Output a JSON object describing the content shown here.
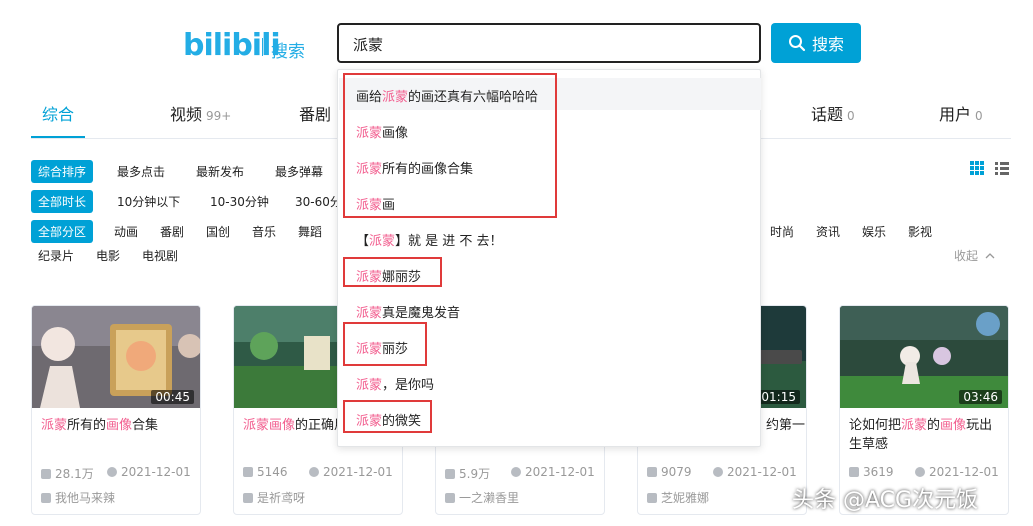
{
  "header": {
    "logo": "bilibili",
    "logo_sub": "搜索",
    "search_value": "派蒙",
    "search_button": "搜索"
  },
  "tabs": [
    {
      "label": "综合",
      "count": ""
    },
    {
      "label": "视频",
      "count": "99+"
    },
    {
      "label": "番剧",
      "count": ""
    },
    {
      "label": "话题",
      "count": "0"
    },
    {
      "label": "用户",
      "count": "0"
    }
  ],
  "filters": {
    "sort": {
      "active": "综合排序",
      "items": [
        "最多点击",
        "最新发布",
        "最多弹幕"
      ]
    },
    "duration": {
      "active": "全部时长",
      "items": [
        "10分钟以下",
        "10-30分钟",
        "30-60分"
      ]
    },
    "zone": {
      "active": "全部分区",
      "items": [
        "动画",
        "番剧",
        "国创",
        "音乐",
        "舞蹈",
        "时尚",
        "资讯",
        "娱乐",
        "影视"
      ],
      "row2": [
        "纪录片",
        "电影",
        "电视剧"
      ]
    },
    "fold": "收起"
  },
  "suggestions": [
    {
      "pre": "画给",
      "hl": "派蒙",
      "post": "的画还真有六幅哈哈哈"
    },
    {
      "pre": "",
      "hl": "派蒙",
      "post": "画像"
    },
    {
      "pre": "",
      "hl": "派蒙",
      "post": "所有的画像合集"
    },
    {
      "pre": "",
      "hl": "派蒙",
      "post": "画"
    },
    {
      "pre": "【",
      "hl": "派蒙",
      "post": "】就 是 进 不 去！"
    },
    {
      "pre": "",
      "hl": "派蒙",
      "post": "娜丽莎"
    },
    {
      "pre": "",
      "hl": "派蒙",
      "post": "真是魔鬼发音"
    },
    {
      "pre": "",
      "hl": "派蒙",
      "post": "丽莎"
    },
    {
      "pre": "",
      "hl": "派蒙",
      "post": "，是你吗"
    },
    {
      "pre": "",
      "hl": "派蒙",
      "post": "的微笑"
    }
  ],
  "cards": [
    {
      "duration": "00:45",
      "title_parts": [
        [
          "派蒙",
          true
        ],
        [
          "所有的",
          false
        ],
        [
          "画像",
          true
        ],
        [
          "合集",
          false
        ]
      ],
      "views": "28.1万",
      "date": "2021-12-01",
      "uploader": "我他马来辣"
    },
    {
      "duration": "",
      "title_parts": [
        [
          "派蒙画像",
          true
        ],
        [
          "的正确用",
          false
        ]
      ],
      "views": "5146",
      "date": "2021-12-01",
      "uploader": "是祈鸢呀"
    },
    {
      "duration": "",
      "title_parts": [],
      "views": "5.9万",
      "date": "2021-12-01",
      "uploader": "一之濑香里"
    },
    {
      "duration": "01:15",
      "title_parts": [
        [
          "约第一",
          false
        ]
      ],
      "views": "9079",
      "date": "2021-12-01",
      "uploader": "芝妮雅娜"
    },
    {
      "duration": "03:46",
      "title_parts": [
        [
          "论如何把",
          false
        ],
        [
          "派蒙",
          true
        ],
        [
          "的",
          false
        ],
        [
          "画像",
          true
        ],
        [
          "玩出生草感",
          false
        ]
      ],
      "views": "3619",
      "date": "2021-12-01",
      "uploader": ""
    }
  ],
  "watermark": "头条 @ACG次元饭",
  "colors": {
    "accent": "#00A1D6",
    "highlight": "#F25D8E",
    "annotation_red": "#E03A3A"
  }
}
